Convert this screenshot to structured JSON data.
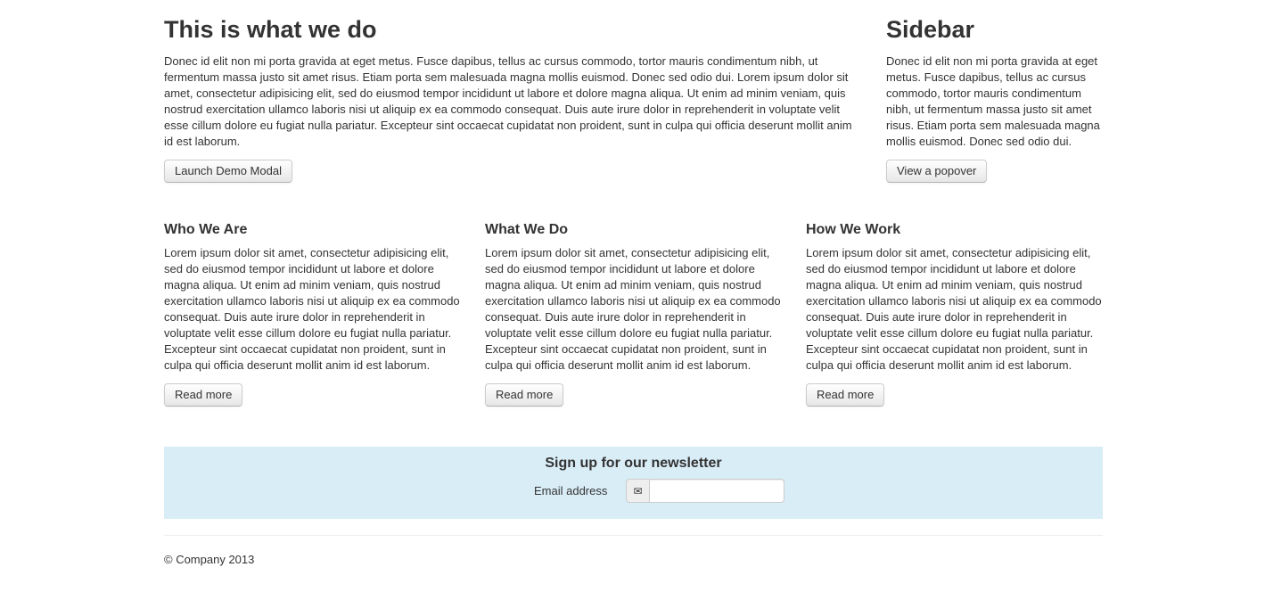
{
  "hero": {
    "title": "This is what we do",
    "text": "Donec id elit non mi porta gravida at eget metus. Fusce dapibus, tellus ac cursus commodo, tortor mauris condimentum nibh, ut fermentum massa justo sit amet risus. Etiam porta sem malesuada magna mollis euismod. Donec sed odio dui. Lorem ipsum dolor sit amet, consectetur adipisicing elit, sed do eiusmod tempor incididunt ut labore et dolore magna aliqua. Ut enim ad minim veniam, quis nostrud exercitation ullamco laboris nisi ut aliquip ex ea commodo consequat. Duis aute irure dolor in reprehenderit in voluptate velit esse cillum dolore eu fugiat nulla pariatur. Excepteur sint occaecat cupidatat non proident, sunt in culpa qui officia deserunt mollit anim id est laborum.",
    "button": "Launch Demo Modal"
  },
  "sidebar": {
    "title": "Sidebar",
    "text": "Donec id elit non mi porta gravida at eget metus. Fusce dapibus, tellus ac cursus commodo, tortor mauris condimentum nibh, ut fermentum massa justo sit amet risus. Etiam porta sem malesuada magna mollis euismod. Donec sed odio dui.",
    "button": "View a popover"
  },
  "columns": [
    {
      "title": "Who We Are",
      "text": "Lorem ipsum dolor sit amet, consectetur adipisicing elit, sed do eiusmod tempor incididunt ut labore et dolore magna aliqua. Ut enim ad minim veniam, quis nostrud exercitation ullamco laboris nisi ut aliquip ex ea commodo consequat. Duis aute irure dolor in reprehenderit in voluptate velit esse cillum dolore eu fugiat nulla pariatur. Excepteur sint occaecat cupidatat non proident, sunt in culpa qui officia deserunt mollit anim id est laborum.",
      "button": "Read more"
    },
    {
      "title": "What We Do",
      "text": "Lorem ipsum dolor sit amet, consectetur adipisicing elit, sed do eiusmod tempor incididunt ut labore et dolore magna aliqua. Ut enim ad minim veniam, quis nostrud exercitation ullamco laboris nisi ut aliquip ex ea commodo consequat. Duis aute irure dolor in reprehenderit in voluptate velit esse cillum dolore eu fugiat nulla pariatur. Excepteur sint occaecat cupidatat non proident, sunt in culpa qui officia deserunt mollit anim id est laborum.",
      "button": "Read more"
    },
    {
      "title": "How We Work",
      "text": "Lorem ipsum dolor sit amet, consectetur adipisicing elit, sed do eiusmod tempor incididunt ut labore et dolore magna aliqua. Ut enim ad minim veniam, quis nostrud exercitation ullamco laboris nisi ut aliquip ex ea commodo consequat. Duis aute irure dolor in reprehenderit in voluptate velit esse cillum dolore eu fugiat nulla pariatur. Excepteur sint occaecat cupidatat non proident, sunt in culpa qui officia deserunt mollit anim id est laborum.",
      "button": "Read more"
    }
  ],
  "newsletter": {
    "title": "Sign up for our newsletter",
    "email_label": "Email address",
    "email_icon": "envelope-icon",
    "email_glyph": "✉",
    "email_value": "",
    "background": "#d9edf7"
  },
  "footer": {
    "copyright": "© Company 2013"
  }
}
